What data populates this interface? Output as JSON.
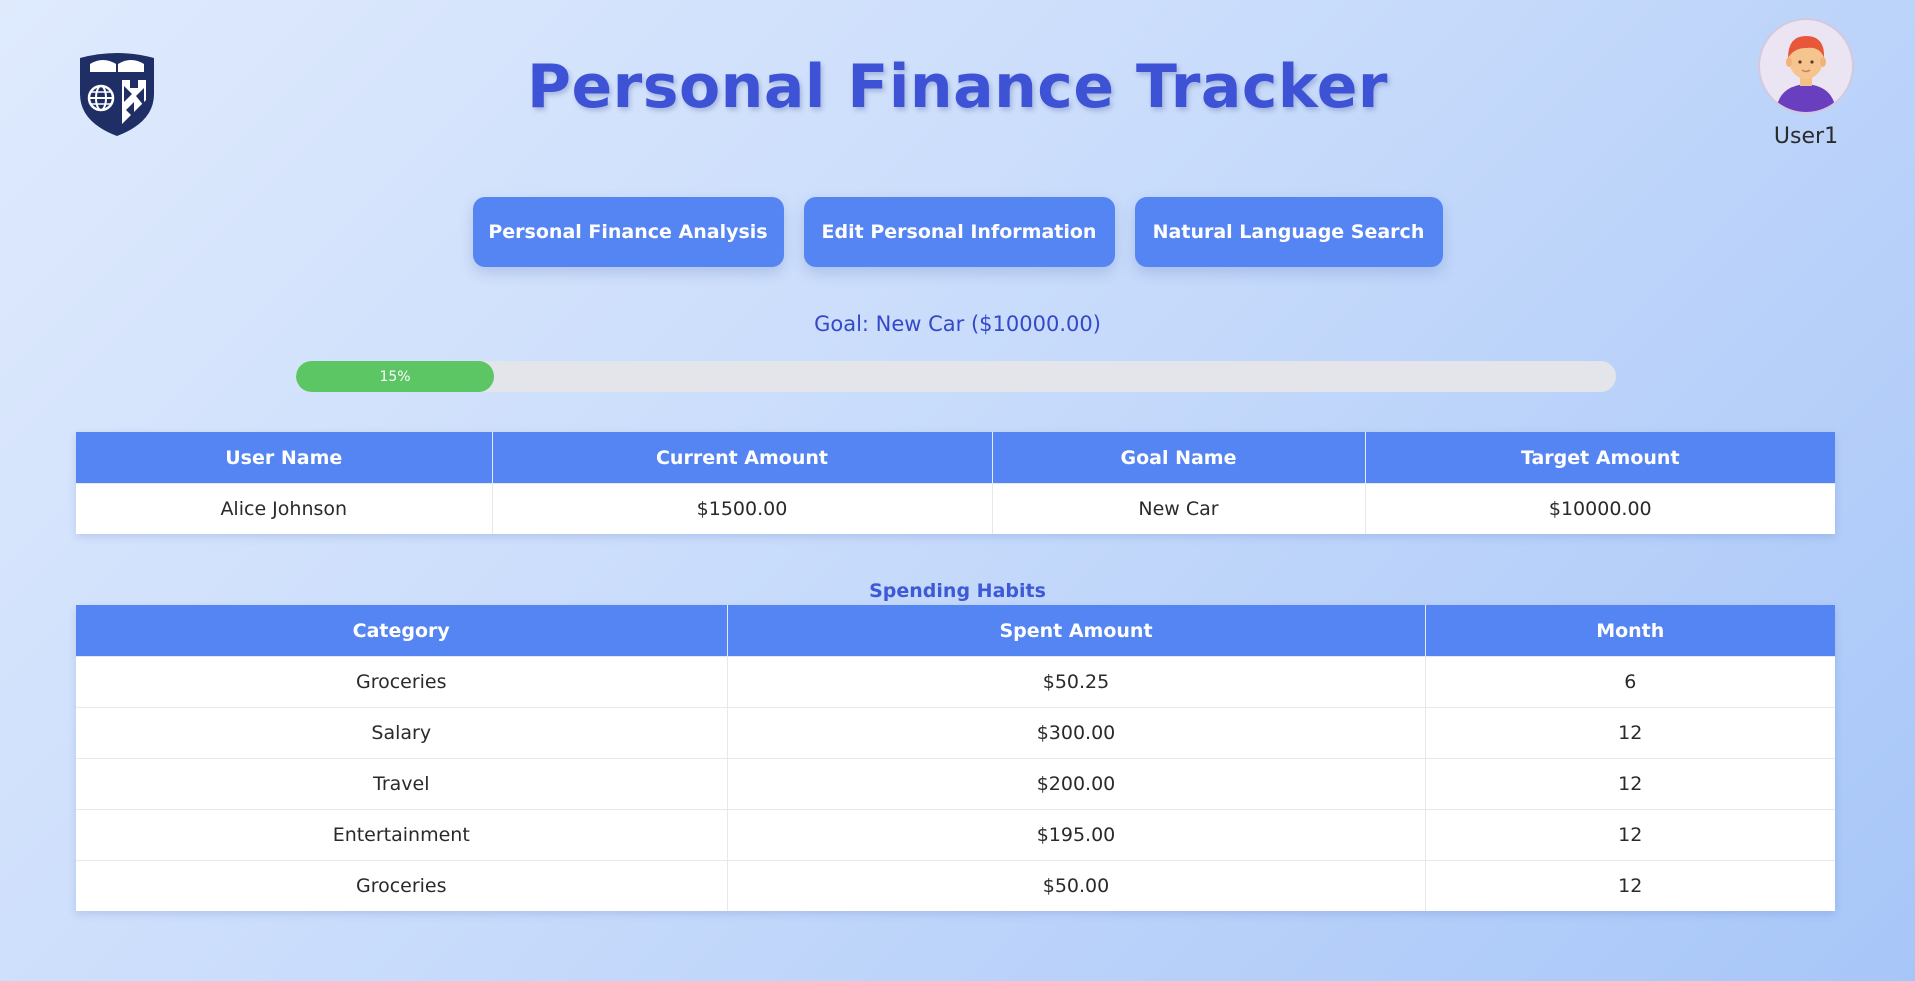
{
  "header": {
    "title": "Personal Finance Tracker",
    "logo_icon": "university-shield-logo",
    "user": {
      "name": "User1",
      "avatar_icon": "user-avatar-icon"
    }
  },
  "nav": {
    "buttons": [
      {
        "label": "Personal Finance Analysis"
      },
      {
        "label": "Edit Personal Information"
      },
      {
        "label": "Natural Language Search"
      }
    ]
  },
  "goal": {
    "label": "Goal: New Car ($10000.00)",
    "progress_percent": 15,
    "progress_text": "15%",
    "progress_color": "#5cc564"
  },
  "summary_table": {
    "headers": [
      "User Name",
      "Current Amount",
      "Goal Name",
      "Target Amount"
    ],
    "rows": [
      [
        "Alice Johnson",
        "$1500.00",
        "New Car",
        "$10000.00"
      ]
    ]
  },
  "spending": {
    "title": "Spending Habits",
    "headers": [
      "Category",
      "Spent Amount",
      "Month"
    ],
    "rows": [
      [
        "Groceries",
        "$50.25",
        "6"
      ],
      [
        "Salary",
        "$300.00",
        "12"
      ],
      [
        "Travel",
        "$200.00",
        "12"
      ],
      [
        "Entertainment",
        "$195.00",
        "12"
      ],
      [
        "Groceries",
        "$50.00",
        "12"
      ]
    ]
  },
  "colors": {
    "accent": "#5585f2",
    "title": "#3d52d5",
    "progress": "#5cc564"
  }
}
